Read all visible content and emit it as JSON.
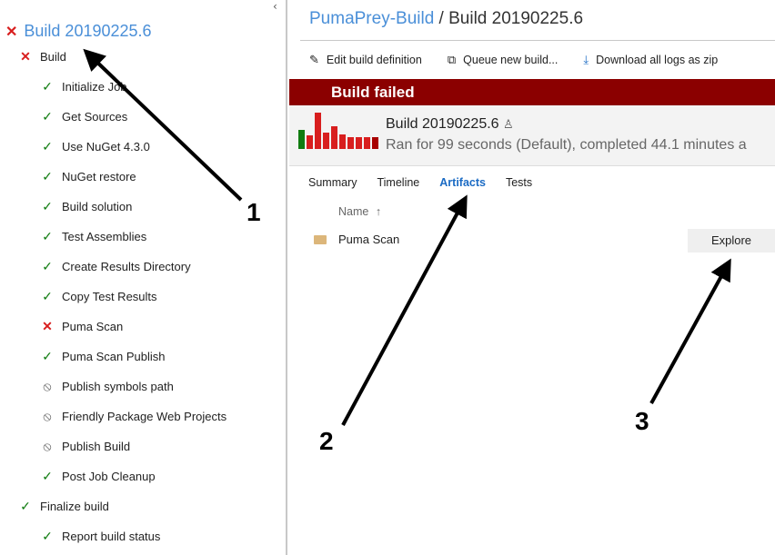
{
  "left_panel": {
    "collapse_glyph": "‹",
    "root": {
      "label": "Build 20190225.6",
      "status": "failed",
      "icon": "✕"
    },
    "nodes": [
      {
        "label": "Build",
        "status": "failed",
        "icon": "✕",
        "level": 1
      },
      {
        "label": "Initialize Job",
        "status": "succeeded",
        "icon": "✓",
        "level": 2
      },
      {
        "label": "Get Sources",
        "status": "succeeded",
        "icon": "✓",
        "level": 2
      },
      {
        "label": "Use NuGet 4.3.0",
        "status": "succeeded",
        "icon": "✓",
        "level": 2
      },
      {
        "label": "NuGet restore",
        "status": "succeeded",
        "icon": "✓",
        "level": 2
      },
      {
        "label": "Build solution",
        "status": "succeeded",
        "icon": "✓",
        "level": 2
      },
      {
        "label": "Test Assemblies",
        "status": "succeeded",
        "icon": "✓",
        "level": 2
      },
      {
        "label": "Create Results Directory",
        "status": "succeeded",
        "icon": "✓",
        "level": 2
      },
      {
        "label": "Copy Test Results",
        "status": "succeeded",
        "icon": "✓",
        "level": 2
      },
      {
        "label": "Puma Scan",
        "status": "failed",
        "icon": "✕",
        "level": 2
      },
      {
        "label": "Puma Scan Publish",
        "status": "succeeded",
        "icon": "✓",
        "level": 2
      },
      {
        "label": "Publish symbols path",
        "status": "skipped",
        "icon": "⃠",
        "level": 2
      },
      {
        "label": "Friendly Package Web Projects",
        "status": "skipped",
        "icon": "⃠",
        "level": 2
      },
      {
        "label": "Publish Build",
        "status": "skipped",
        "icon": "⃠",
        "level": 2
      },
      {
        "label": "Post Job Cleanup",
        "status": "succeeded",
        "icon": "✓",
        "level": 2
      },
      {
        "label": "Finalize build",
        "status": "succeeded",
        "icon": "✓",
        "level": 1
      },
      {
        "label": "Report build status",
        "status": "succeeded",
        "icon": "✓",
        "level": 2
      }
    ]
  },
  "header": {
    "breadcrumb_link": "PumaPrey-Build",
    "separator": " / ",
    "current": "Build 20190225.6"
  },
  "toolbar": {
    "edit": {
      "label": "Edit build definition",
      "icon": "✎"
    },
    "queue": {
      "label": "Queue new build...",
      "icon": "⧉"
    },
    "download": {
      "label": "Download all logs as zip",
      "icon": "⤓"
    }
  },
  "banner": {
    "text": "Build failed",
    "color": "#8b0000"
  },
  "summary": {
    "title": "Build 20190225.6",
    "person_icon": "♙",
    "subtitle": "Ran for 99 seconds (Default), completed 44.1 minutes a",
    "history_bars": [
      {
        "value": 20,
        "status": "succeeded"
      },
      {
        "value": 14,
        "status": "failed"
      },
      {
        "value": 38,
        "status": "failed"
      },
      {
        "value": 17,
        "status": "failed"
      },
      {
        "value": 24,
        "status": "failed"
      },
      {
        "value": 15,
        "status": "failed"
      },
      {
        "value": 12,
        "status": "failed"
      },
      {
        "value": 12,
        "status": "failed"
      },
      {
        "value": 12,
        "status": "failed"
      },
      {
        "value": 12,
        "status": "current"
      }
    ]
  },
  "tabs": [
    {
      "label": "Summary",
      "active": false
    },
    {
      "label": "Timeline",
      "active": false
    },
    {
      "label": "Artifacts",
      "active": true
    },
    {
      "label": "Tests",
      "active": false
    }
  ],
  "artifacts": {
    "column_header": "Name",
    "sort_icon": "↑",
    "items": [
      {
        "name": "Puma Scan",
        "action": "Explore"
      }
    ]
  },
  "annotations": [
    {
      "number": "1"
    },
    {
      "number": "2"
    },
    {
      "number": "3"
    }
  ],
  "colors": {
    "succeeded": "#107c10",
    "failed": "#d81e1e",
    "current": "#a80000",
    "accent": "#1b6bc4"
  }
}
